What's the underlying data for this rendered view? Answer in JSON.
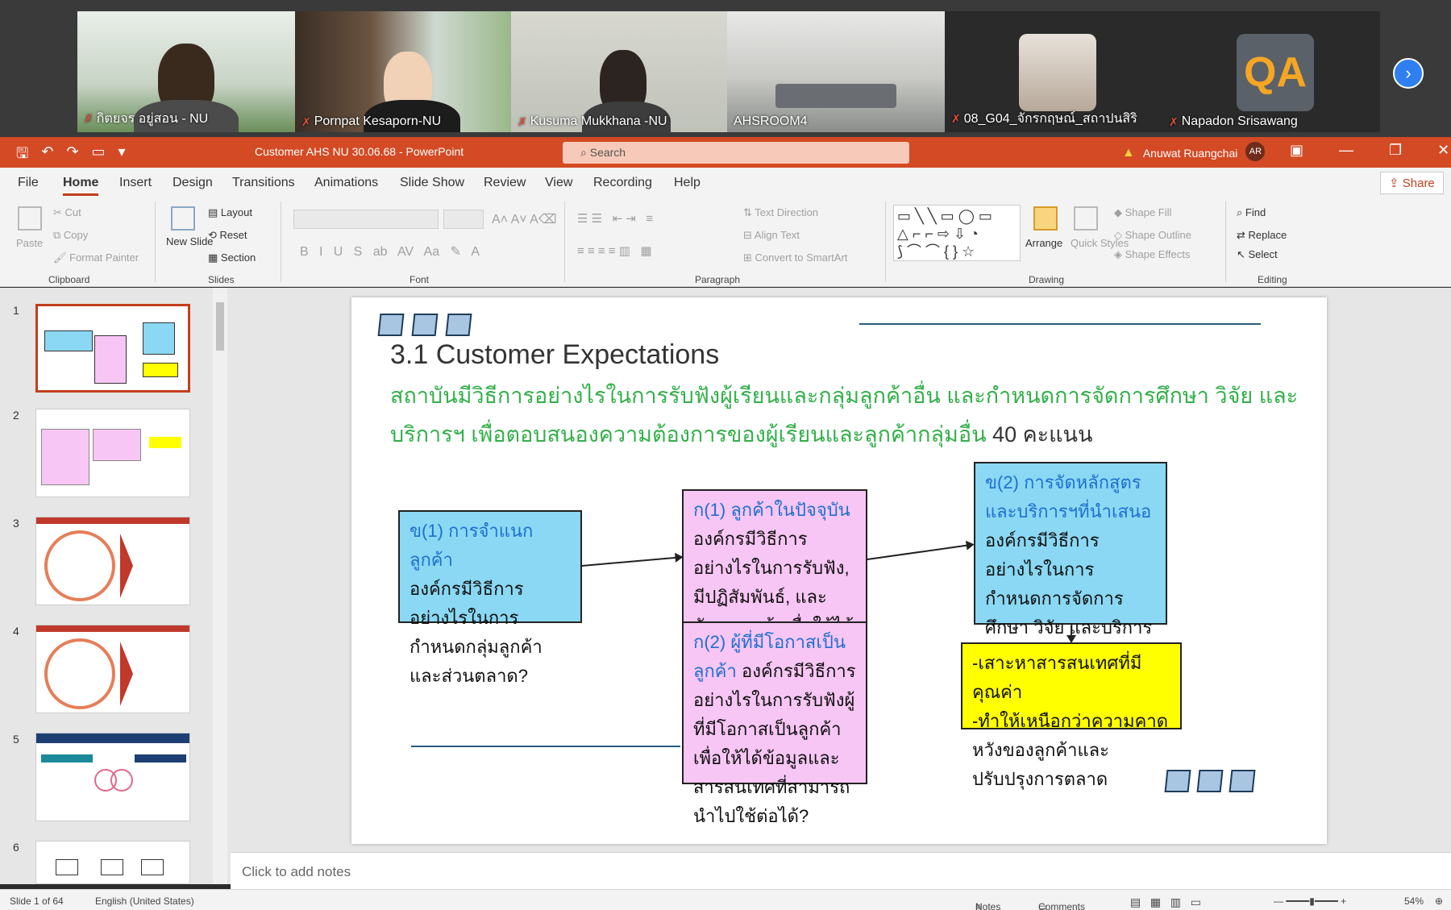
{
  "participants": [
    {
      "name": "กิตยจร อยู่สอน - NU",
      "muted": true
    },
    {
      "name": "Pornpat Kesaporn-NU",
      "muted": true
    },
    {
      "name": "Kusuma Mukkhana -NU",
      "muted": true
    },
    {
      "name": "AHSROOM4",
      "muted": false
    },
    {
      "name": "08_G04_จักรกฤษณ์_สถาปนสิริ",
      "muted": true
    },
    {
      "name": "Napadon Srisawang",
      "muted": true
    }
  ],
  "qa_logo": "QA",
  "title_bar": {
    "document": "Customer AHS NU 30.06.68  -  PowerPoint",
    "search_placeholder": "Search",
    "user": "Anuwat Ruangchai",
    "user_initials": "AR"
  },
  "menu": [
    "File",
    "Home",
    "Insert",
    "Design",
    "Transitions",
    "Animations",
    "Slide Show",
    "Review",
    "View",
    "Recording",
    "Help"
  ],
  "selected_menu": "Home",
  "share_label": "Share",
  "ribbon": {
    "clipboard": {
      "paste": "Paste",
      "cut": "Cut",
      "copy": "Copy",
      "format_painter": "Format Painter",
      "group": "Clipboard"
    },
    "slides": {
      "new_slide": "New Slide",
      "layout": "Layout",
      "reset": "Reset",
      "section": "Section",
      "group": "Slides"
    },
    "font": {
      "group": "Font"
    },
    "paragraph": {
      "text_direction": "Text Direction",
      "align_text": "Align Text",
      "convert": "Convert to SmartArt",
      "group": "Paragraph"
    },
    "drawing": {
      "arrange": "Arrange",
      "quick_styles": "Quick Styles",
      "shape_fill": "Shape Fill",
      "shape_outline": "Shape Outline",
      "shape_effects": "Shape Effects",
      "group": "Drawing"
    },
    "editing": {
      "find": "Find",
      "replace": "Replace",
      "select": "Select",
      "group": "Editing"
    }
  },
  "thumbnails": [
    "1",
    "2",
    "3",
    "4",
    "5",
    "6"
  ],
  "slide": {
    "title": "3.1 Customer Expectations",
    "question": "สถาบันมีวิธีการอย่างไรในการรับฟังผู้เรียนและกลุ่มลูกค้าอื่น และกำหนดการจัดการศึกษา วิจัย และบริการฯ เพื่อตอบสนองความต้องการของผู้เรียนและลูกค้ากลุ่มอื่น",
    "points": "40 คะแนน",
    "box_b1_head": "ข(1) การจำแนกลูกค้า",
    "box_b1_body": "องค์กรมีวิธีการอย่างไรในการกำหนดกลุ่มลูกค้า และส่วนตลาด?",
    "box_a1_head": "ก(1) ลูกค้าในปัจจุบัน",
    "box_a1_body": "องค์กรมีวิธีการอย่างไรในการรับฟัง, มีปฏิสัมพันธ์, และสังเกตลูกค้าเพื่อให้ได้สารสนเทศที่สามารถนำไปใช้ต่อได้?",
    "box_a2_head": "ก(2) ผู้ที่มีโอกาสเป็นลูกค้า",
    "box_a2_body": "องค์กรมีวิธีการอย่างไรในการรับฟังผู้ที่มีโอกาสเป็นลูกค้าเพื่อให้ได้ข้อมูลและสารสนเทศที่สามารถนำไปใช้ต่อได้?",
    "box_b2_head": "ข(2) การจัดหลักสูตรและบริการฯที่นำเสนอ",
    "box_b2_body": "องค์กรมีวิธีการอย่างไรในการกำหนดการจัดการศึกษา วิจัย และบริการทางการศึกษาอื่นๆที่นำเสนอ?",
    "box_yellow_line1": "-เสาะหาสารสนเทศที่มีคุณค่า",
    "box_yellow_line2": "-ทำให้เหนือกว่าความคาดหวังของลูกค้าและปรับปรุงการตลาด"
  },
  "notes_placeholder": "Click to add notes",
  "status": {
    "slide_info": "Slide 1 of 64",
    "language": "English (United States)",
    "notes": "Notes",
    "comments": "Comments",
    "zoom": "54%"
  },
  "colors": {
    "accent": "#d34a24",
    "cyan_box": "#8ad8f3",
    "pink_box": "#f7c6f4",
    "yellow_box": "#ffff00",
    "question_green": "#33b04a"
  }
}
